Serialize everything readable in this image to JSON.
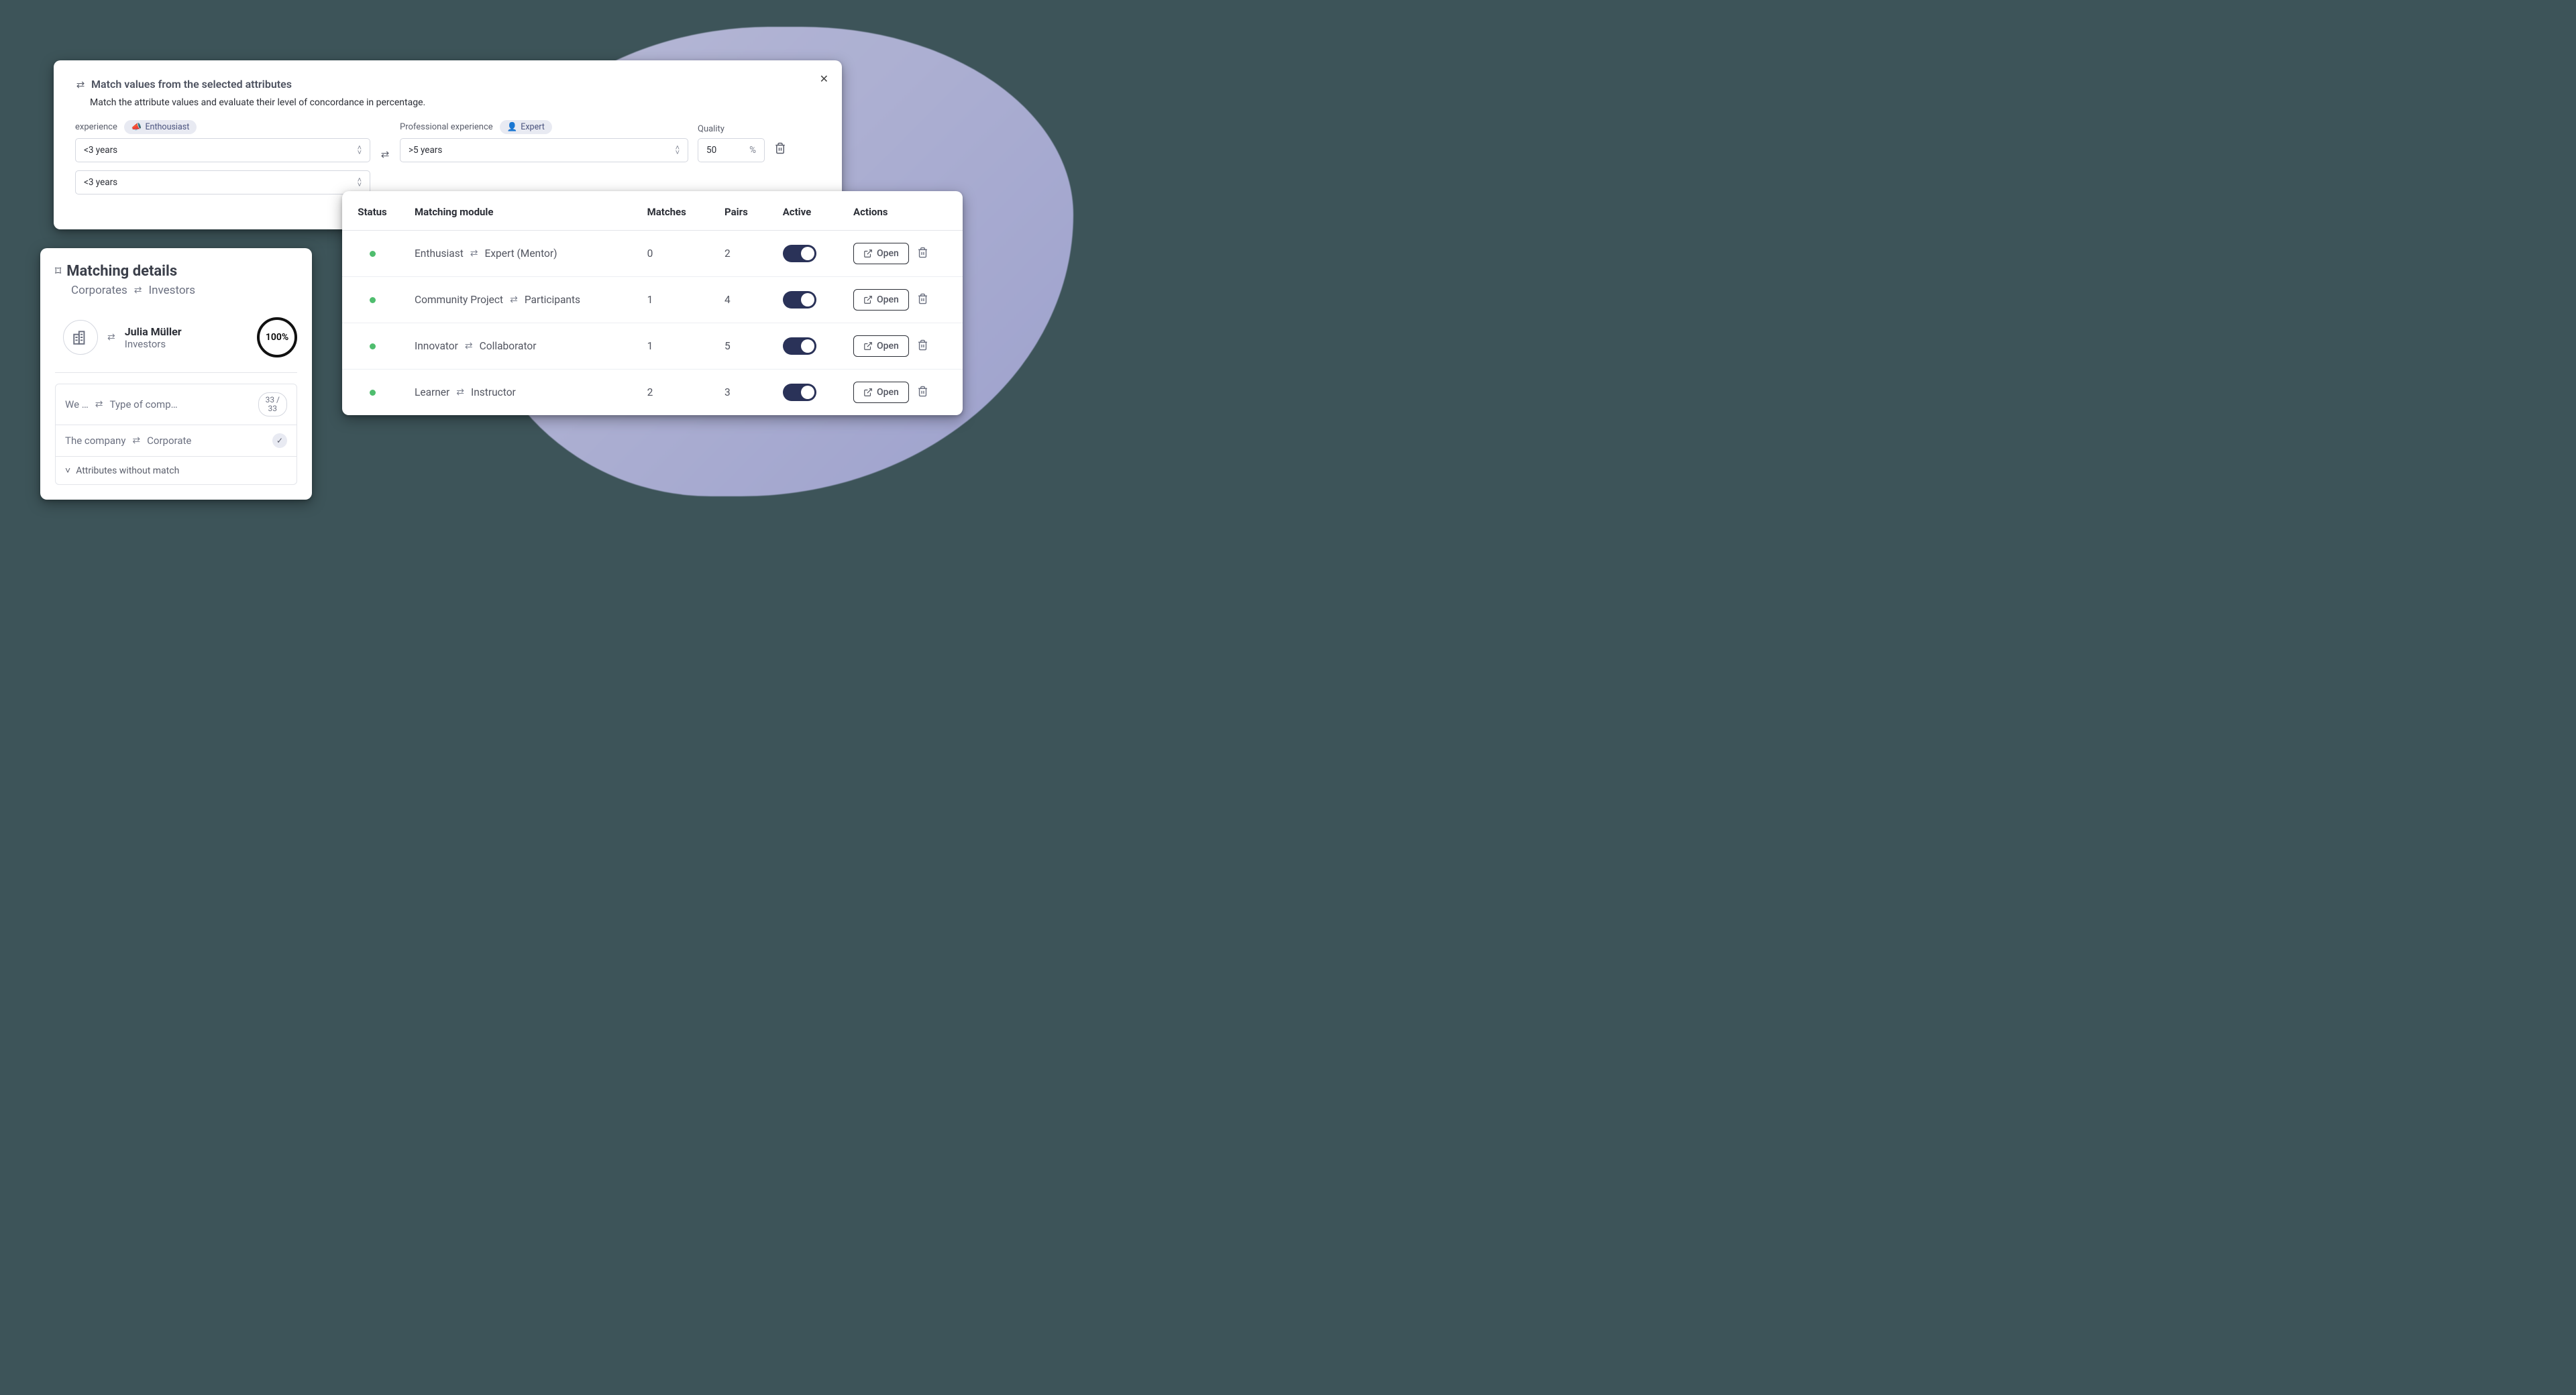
{
  "matchCard": {
    "title": "Match values from the selected attributes",
    "sub": "Match the attribute values and evaluate their level of concordance in percentage.",
    "experience": {
      "label": "experience",
      "chip": "Enthousiast",
      "value": "<3 years",
      "value2": "<3 years"
    },
    "professional": {
      "label": "Professional experience",
      "chip": "Expert",
      "value": ">5 years"
    },
    "quality": {
      "label": "Quality",
      "value": "50",
      "unit": "%"
    }
  },
  "details": {
    "title": "Matching details",
    "left": "Corporates",
    "right": "Investors",
    "person": {
      "name": "Julia Müller",
      "role": "Investors"
    },
    "score": "100%",
    "attr1": {
      "left": "We …",
      "right": "Type of comp…",
      "num": "33 /",
      "den": "33"
    },
    "attr2": {
      "left": "The company",
      "right": "Corporate"
    },
    "expand": "Attributes without match"
  },
  "table": {
    "headers": {
      "status": "Status",
      "module": "Matching module",
      "matches": "Matches",
      "pairs": "Pairs",
      "active": "Active",
      "actions": "Actions"
    },
    "openLabel": "Open",
    "rows": [
      {
        "left": "Enthusiast",
        "right": "Expert (Mentor)",
        "matches": "0",
        "pairs": "2"
      },
      {
        "left": "Community Project",
        "right": "Participants",
        "matches": "1",
        "pairs": "4"
      },
      {
        "left": "Innovator",
        "right": "Collaborator",
        "matches": "1",
        "pairs": "5"
      },
      {
        "left": "Learner",
        "right": "Instructor",
        "matches": "2",
        "pairs": "3"
      }
    ]
  }
}
